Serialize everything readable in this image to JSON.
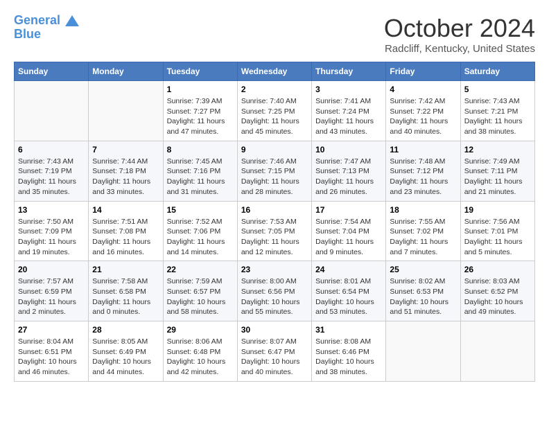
{
  "header": {
    "logo_line1": "General",
    "logo_line2": "Blue",
    "month": "October 2024",
    "location": "Radcliff, Kentucky, United States"
  },
  "weekdays": [
    "Sunday",
    "Monday",
    "Tuesday",
    "Wednesday",
    "Thursday",
    "Friday",
    "Saturday"
  ],
  "weeks": [
    [
      {
        "day": "",
        "info": ""
      },
      {
        "day": "",
        "info": ""
      },
      {
        "day": "1",
        "info": "Sunrise: 7:39 AM\nSunset: 7:27 PM\nDaylight: 11 hours and 47 minutes."
      },
      {
        "day": "2",
        "info": "Sunrise: 7:40 AM\nSunset: 7:25 PM\nDaylight: 11 hours and 45 minutes."
      },
      {
        "day": "3",
        "info": "Sunrise: 7:41 AM\nSunset: 7:24 PM\nDaylight: 11 hours and 43 minutes."
      },
      {
        "day": "4",
        "info": "Sunrise: 7:42 AM\nSunset: 7:22 PM\nDaylight: 11 hours and 40 minutes."
      },
      {
        "day": "5",
        "info": "Sunrise: 7:43 AM\nSunset: 7:21 PM\nDaylight: 11 hours and 38 minutes."
      }
    ],
    [
      {
        "day": "6",
        "info": "Sunrise: 7:43 AM\nSunset: 7:19 PM\nDaylight: 11 hours and 35 minutes."
      },
      {
        "day": "7",
        "info": "Sunrise: 7:44 AM\nSunset: 7:18 PM\nDaylight: 11 hours and 33 minutes."
      },
      {
        "day": "8",
        "info": "Sunrise: 7:45 AM\nSunset: 7:16 PM\nDaylight: 11 hours and 31 minutes."
      },
      {
        "day": "9",
        "info": "Sunrise: 7:46 AM\nSunset: 7:15 PM\nDaylight: 11 hours and 28 minutes."
      },
      {
        "day": "10",
        "info": "Sunrise: 7:47 AM\nSunset: 7:13 PM\nDaylight: 11 hours and 26 minutes."
      },
      {
        "day": "11",
        "info": "Sunrise: 7:48 AM\nSunset: 7:12 PM\nDaylight: 11 hours and 23 minutes."
      },
      {
        "day": "12",
        "info": "Sunrise: 7:49 AM\nSunset: 7:11 PM\nDaylight: 11 hours and 21 minutes."
      }
    ],
    [
      {
        "day": "13",
        "info": "Sunrise: 7:50 AM\nSunset: 7:09 PM\nDaylight: 11 hours and 19 minutes."
      },
      {
        "day": "14",
        "info": "Sunrise: 7:51 AM\nSunset: 7:08 PM\nDaylight: 11 hours and 16 minutes."
      },
      {
        "day": "15",
        "info": "Sunrise: 7:52 AM\nSunset: 7:06 PM\nDaylight: 11 hours and 14 minutes."
      },
      {
        "day": "16",
        "info": "Sunrise: 7:53 AM\nSunset: 7:05 PM\nDaylight: 11 hours and 12 minutes."
      },
      {
        "day": "17",
        "info": "Sunrise: 7:54 AM\nSunset: 7:04 PM\nDaylight: 11 hours and 9 minutes."
      },
      {
        "day": "18",
        "info": "Sunrise: 7:55 AM\nSunset: 7:02 PM\nDaylight: 11 hours and 7 minutes."
      },
      {
        "day": "19",
        "info": "Sunrise: 7:56 AM\nSunset: 7:01 PM\nDaylight: 11 hours and 5 minutes."
      }
    ],
    [
      {
        "day": "20",
        "info": "Sunrise: 7:57 AM\nSunset: 6:59 PM\nDaylight: 11 hours and 2 minutes."
      },
      {
        "day": "21",
        "info": "Sunrise: 7:58 AM\nSunset: 6:58 PM\nDaylight: 11 hours and 0 minutes."
      },
      {
        "day": "22",
        "info": "Sunrise: 7:59 AM\nSunset: 6:57 PM\nDaylight: 10 hours and 58 minutes."
      },
      {
        "day": "23",
        "info": "Sunrise: 8:00 AM\nSunset: 6:56 PM\nDaylight: 10 hours and 55 minutes."
      },
      {
        "day": "24",
        "info": "Sunrise: 8:01 AM\nSunset: 6:54 PM\nDaylight: 10 hours and 53 minutes."
      },
      {
        "day": "25",
        "info": "Sunrise: 8:02 AM\nSunset: 6:53 PM\nDaylight: 10 hours and 51 minutes."
      },
      {
        "day": "26",
        "info": "Sunrise: 8:03 AM\nSunset: 6:52 PM\nDaylight: 10 hours and 49 minutes."
      }
    ],
    [
      {
        "day": "27",
        "info": "Sunrise: 8:04 AM\nSunset: 6:51 PM\nDaylight: 10 hours and 46 minutes."
      },
      {
        "day": "28",
        "info": "Sunrise: 8:05 AM\nSunset: 6:49 PM\nDaylight: 10 hours and 44 minutes."
      },
      {
        "day": "29",
        "info": "Sunrise: 8:06 AM\nSunset: 6:48 PM\nDaylight: 10 hours and 42 minutes."
      },
      {
        "day": "30",
        "info": "Sunrise: 8:07 AM\nSunset: 6:47 PM\nDaylight: 10 hours and 40 minutes."
      },
      {
        "day": "31",
        "info": "Sunrise: 8:08 AM\nSunset: 6:46 PM\nDaylight: 10 hours and 38 minutes."
      },
      {
        "day": "",
        "info": ""
      },
      {
        "day": "",
        "info": ""
      }
    ]
  ]
}
